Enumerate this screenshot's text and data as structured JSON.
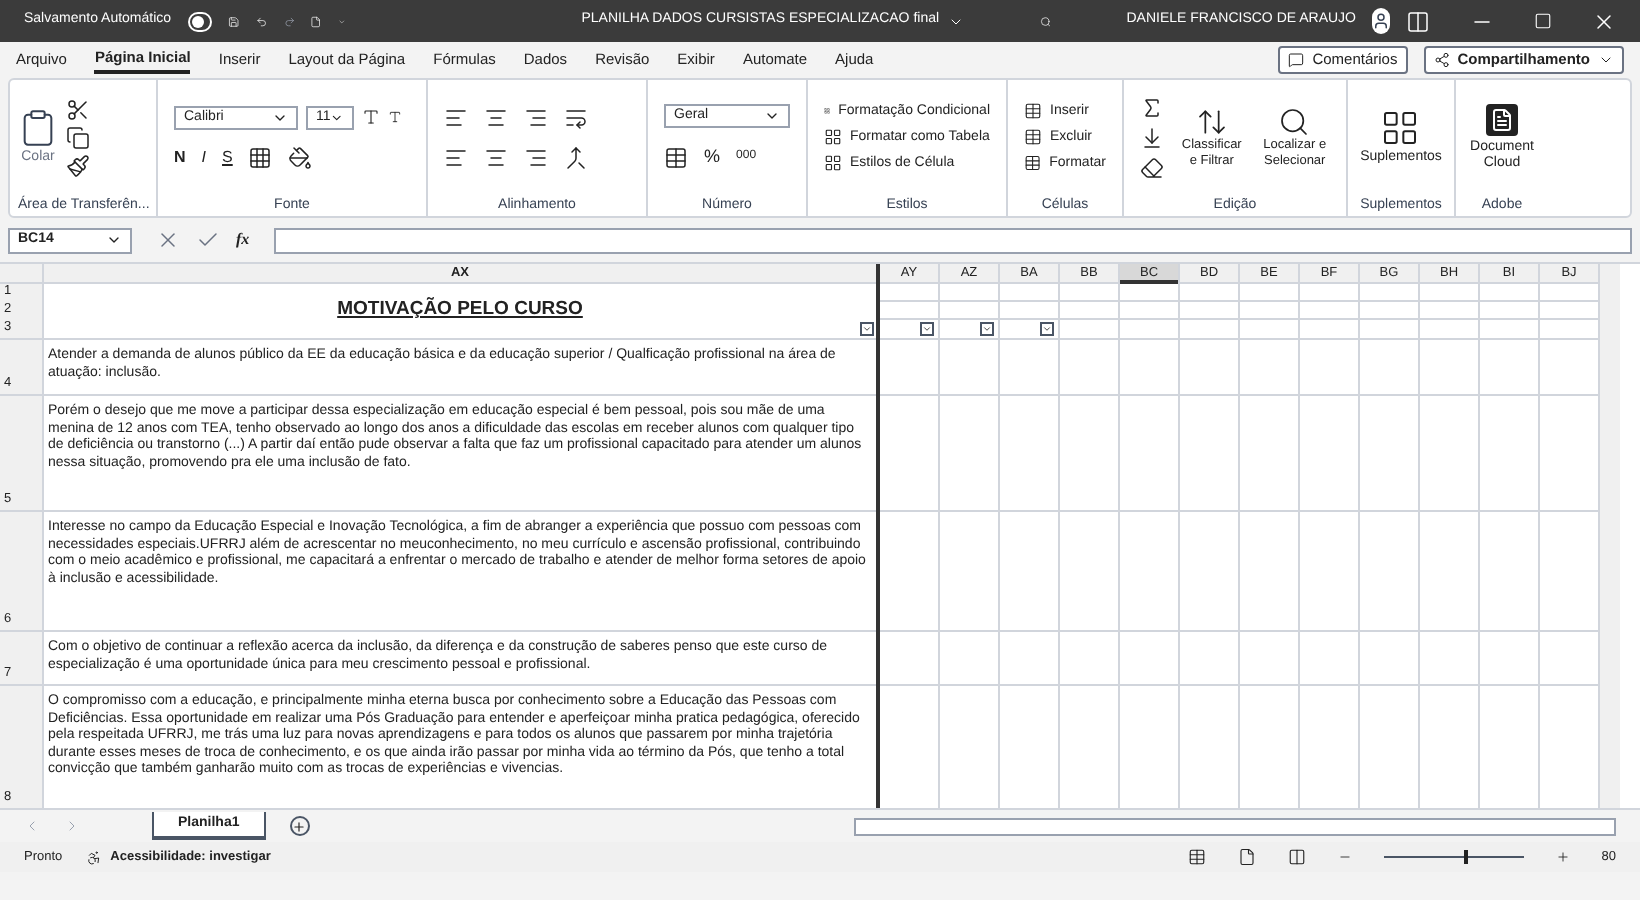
{
  "title_bar": {
    "autosave_label": "Salvamento Automático",
    "autosave_on": false,
    "file_title": "PLANILHA DADOS CURSISTAS ESPECIALIZACAO final",
    "user_name": "DANIELE FRANCISCO DE ARAUJO"
  },
  "menu_tabs": [
    {
      "label": "Arquivo",
      "selected": false
    },
    {
      "label": "Página Inicial",
      "selected": true
    },
    {
      "label": "Inserir",
      "selected": false
    },
    {
      "label": "Layout da Página",
      "selected": false
    },
    {
      "label": "Fórmulas",
      "selected": false
    },
    {
      "label": "Dados",
      "selected": false
    },
    {
      "label": "Revisão",
      "selected": false
    },
    {
      "label": "Exibir",
      "selected": false
    },
    {
      "label": "Automate",
      "selected": false
    },
    {
      "label": "Ajuda",
      "selected": false
    }
  ],
  "header_buttons": {
    "comments": "Comentários",
    "share": "Compartilhamento"
  },
  "ribbon": {
    "clipboard": {
      "paste": "Colar",
      "label": "Área de Transferên..."
    },
    "font": {
      "name": "Calibri",
      "size": "11",
      "bold": "N",
      "italic": "I",
      "underline": "S",
      "label": "Fonte"
    },
    "alignment": {
      "label": "Alinhamento"
    },
    "number": {
      "format": "Geral",
      "percent": "%",
      "thousands": "000",
      "label": "Número"
    },
    "styles": {
      "items": [
        "Formatação Condicional",
        "Formatar como Tabela",
        "Estilos de Célula"
      ],
      "label": "Estilos"
    },
    "cells": {
      "items": [
        "Inserir",
        "Excluir",
        "Formatar"
      ],
      "label": "Células"
    },
    "editing": {
      "sort": "Classificar e Filtrar",
      "find": "Localizar e Selecionar",
      "label": "Edição"
    },
    "addins": {
      "button": "Suplementos",
      "label": "Suplementos"
    },
    "adobe": {
      "button": "Document Cloud",
      "label": "Adobe"
    }
  },
  "formula_bar": {
    "name_box": "BC14",
    "fx": "fx"
  },
  "sheet": {
    "columns": [
      {
        "label": "AY",
        "selected": false,
        "filter": true
      },
      {
        "label": "AZ",
        "selected": false,
        "filter": true
      },
      {
        "label": "BA",
        "selected": false,
        "filter": true
      },
      {
        "label": "BB",
        "selected": false,
        "filter": false
      },
      {
        "label": "BC",
        "selected": true,
        "filter": false
      },
      {
        "label": "BD",
        "selected": false,
        "filter": false
      },
      {
        "label": "BE",
        "selected": false,
        "filter": false
      },
      {
        "label": "BF",
        "selected": false,
        "filter": false
      },
      {
        "label": "BG",
        "selected": false,
        "filter": false
      },
      {
        "label": "BH",
        "selected": false,
        "filter": false
      },
      {
        "label": "BI",
        "selected": false,
        "filter": false
      },
      {
        "label": "BJ",
        "selected": false,
        "filter": false
      }
    ],
    "main_column": {
      "label": "AX",
      "filter": true
    },
    "title_rows": [
      "1",
      "2",
      "3"
    ],
    "title": "MOTIVAÇÃO PELO CURSO",
    "rows": [
      {
        "number": "4",
        "text": "Atender a demanda de alunos público da EE da educação básica e da educação superior / Qualficação profissional na área de atuação: inclusão."
      },
      {
        "number": "5",
        "text": "Porém o desejo que me move a participar dessa especialização em educação especial é bem pessoal, pois sou mãe de uma menina de 12 anos com TEA, tenho observado ao longo dos anos a dificuldade das escolas em receber alunos com qualquer tipo de deficiência ou transtorno (...) A partir daí então pude observar a falta que faz um profissional capacitado para atender um alunos nessa situação, promovendo pra ele uma inclusão de fato."
      },
      {
        "number": "6",
        "text": "Interesse no campo da Educação Especial e Inovação Tecnológica, a fim de abranger a experiência que possuo com pessoas com necessidades especiais.UFRRJ além de acrescentar no meuconhecimento, no meu currículo e ascensão profissional, contribuindo com o meio acadêmico e profissional, me capacitará a enfrentar o mercado de trabalho e atender de melhor forma setores de apoio à inclusão e acessibilidade."
      },
      {
        "number": "7",
        "text": "Com o objetivo de continuar a reflexão acerca da inclusão, da diferença e da construção de saberes penso que este curso de especialização é uma oportunidade única para meu crescimento pessoal e profissional."
      },
      {
        "number": "8",
        "text": "O compromisso com a educação, e principalmente minha eterna busca por conhecimento sobre a Educação das Pessoas com Deficiências. Essa oportunidade em realizar uma Pós Graduação para entender e aperfeiçoar minha pratica pedagógica, oferecido pela respeitada UFRRJ, me trás uma luz para novas aprendizagens e para todos os alunos que passarem por minha trajetória durante esses meses de troca de conhecimento, e os que ainda irão passar por minha vida ao término da Pós, que tenho a total convicção que também ganharão muito com as trocas de experiências e vivencias."
      }
    ]
  },
  "sheet_tabs": [
    {
      "label": "Planilha1",
      "selected": true
    }
  ],
  "status_bar": {
    "ready": "Pronto",
    "accessibility": "Acessibilidade: investigar",
    "zoom": "80",
    "zoom_slider": {
      "level": 0.57
    }
  }
}
